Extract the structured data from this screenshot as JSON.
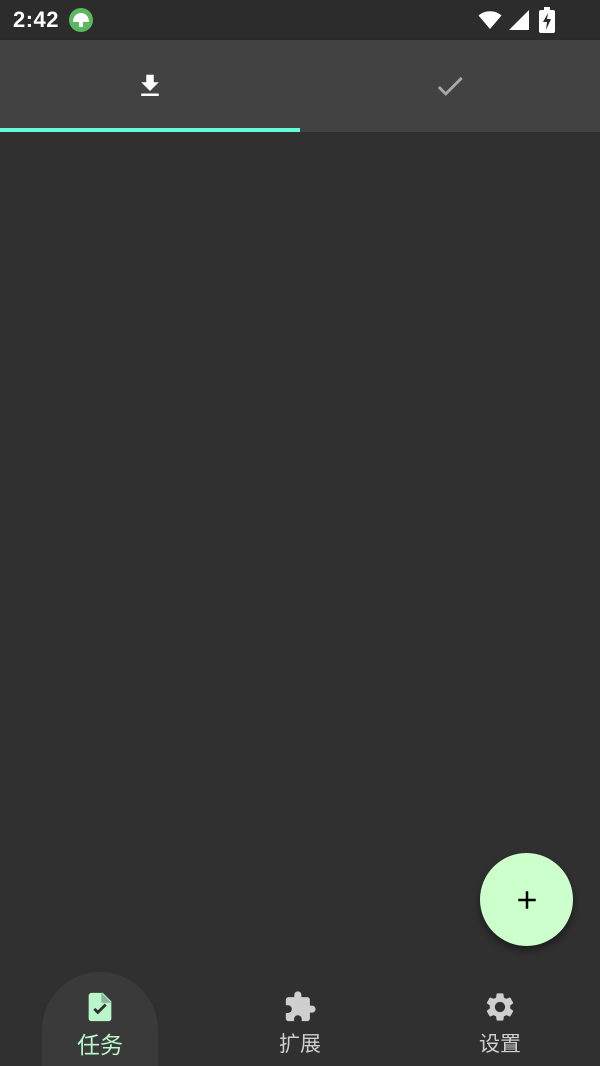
{
  "status_bar": {
    "time": "2:42"
  },
  "tabs": [
    {
      "name": "downloading",
      "icon": "download-icon",
      "selected": true
    },
    {
      "name": "completed",
      "icon": "check-icon",
      "selected": false
    }
  ],
  "colors": {
    "accent": "#64ffda",
    "fab": "#ccffcc",
    "active_nav": "#b9f6ca",
    "background": "#303030",
    "tab_bar": "#424242"
  },
  "fab": {
    "icon": "plus-icon"
  },
  "bottom_nav": {
    "items": [
      {
        "label": "任务",
        "icon": "task-icon",
        "active": true
      },
      {
        "label": "扩展",
        "icon": "puzzle-icon",
        "active": false
      },
      {
        "label": "设置",
        "icon": "gear-icon",
        "active": false
      }
    ]
  }
}
